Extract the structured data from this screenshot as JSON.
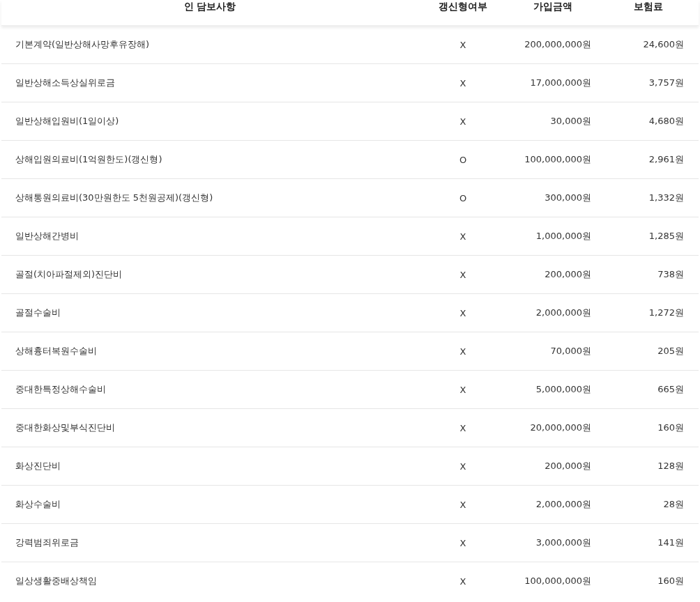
{
  "columns": [
    "인 담보사항",
    "갱신형여부",
    "가입금액",
    "보험료"
  ],
  "rows": [
    {
      "name": "기본계약(일반상해사망후유장해)",
      "renewal": "X",
      "amount": "200,000,000원",
      "premium": "24,600원"
    },
    {
      "name": "일반상해소득상실위로금",
      "renewal": "X",
      "amount": "17,000,000원",
      "premium": "3,757원"
    },
    {
      "name": "일반상해입원비(1일이상)",
      "renewal": "X",
      "amount": "30,000원",
      "premium": "4,680원"
    },
    {
      "name": "상해입원의료비(1억원한도)(갱신형)",
      "renewal": "O",
      "amount": "100,000,000원",
      "premium": "2,961원"
    },
    {
      "name": "상해통원의료비(30만원한도 5천원공제)(갱신형)",
      "renewal": "O",
      "amount": "300,000원",
      "premium": "1,332원"
    },
    {
      "name": "일반상해간병비",
      "renewal": "X",
      "amount": "1,000,000원",
      "premium": "1,285원"
    },
    {
      "name": "골절(치아파절제외)진단비",
      "renewal": "X",
      "amount": "200,000원",
      "premium": "738원"
    },
    {
      "name": "골절수술비",
      "renewal": "X",
      "amount": "2,000,000원",
      "premium": "1,272원"
    },
    {
      "name": "상해흉터복원수술비",
      "renewal": "X",
      "amount": "70,000원",
      "premium": "205원"
    },
    {
      "name": "중대한특정상해수술비",
      "renewal": "X",
      "amount": "5,000,000원",
      "premium": "665원"
    },
    {
      "name": "중대한화상및부식진단비",
      "renewal": "X",
      "amount": "20,000,000원",
      "premium": "160원"
    },
    {
      "name": "화상진단비",
      "renewal": "X",
      "amount": "200,000원",
      "premium": "128원"
    },
    {
      "name": "화상수술비",
      "renewal": "X",
      "amount": "2,000,000원",
      "premium": "28원"
    },
    {
      "name": "강력범죄위로금",
      "renewal": "X",
      "amount": "3,000,000원",
      "premium": "141원"
    },
    {
      "name": "일상생활중배상책임",
      "renewal": "X",
      "amount": "100,000,000원",
      "premium": "160원"
    }
  ]
}
